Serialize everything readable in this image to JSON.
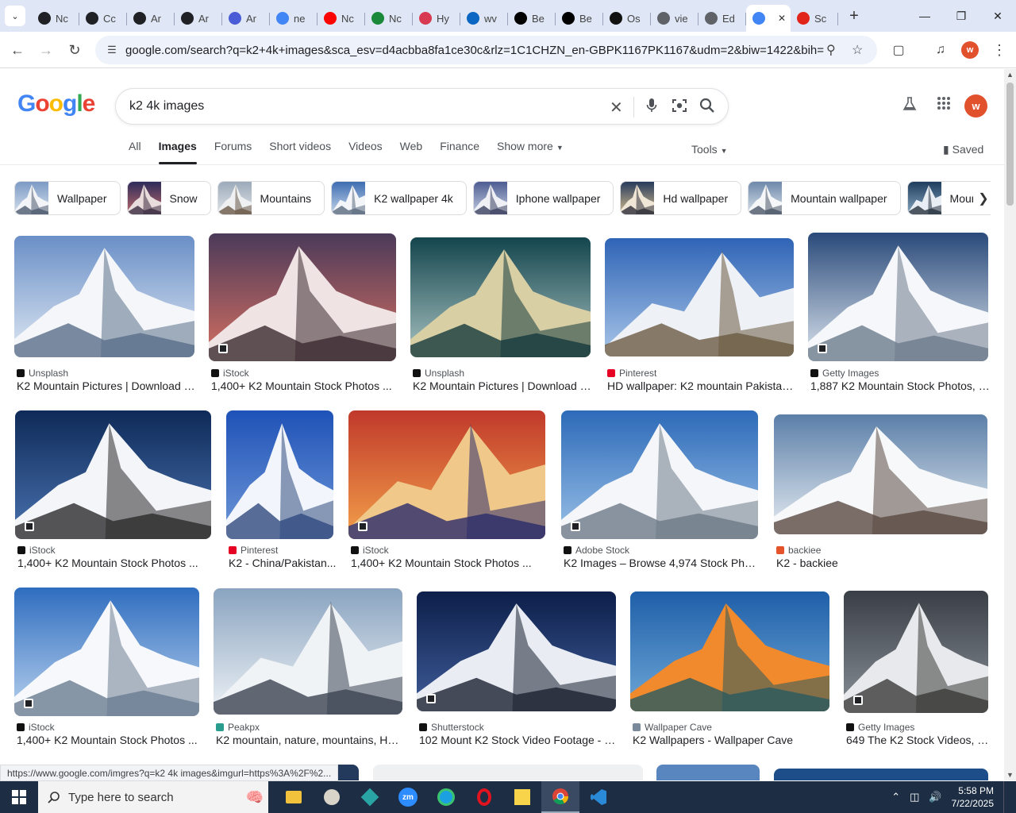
{
  "browser": {
    "tabs": [
      {
        "label": "Nc",
        "icon": "openai-icon",
        "color": "#202124"
      },
      {
        "label": "Cc",
        "icon": "openai-icon",
        "color": "#202124"
      },
      {
        "label": "Ar",
        "icon": "openai-icon",
        "color": "#202124"
      },
      {
        "label": "Ar",
        "icon": "openai-icon",
        "color": "#202124"
      },
      {
        "label": "Ar",
        "icon": "ai-icon",
        "color": "#4a5cd6"
      },
      {
        "label": "ne",
        "icon": "google-icon",
        "color": "#4285f4"
      },
      {
        "label": "Nc",
        "icon": "youtube-icon",
        "color": "#ff0000"
      },
      {
        "label": "Nc",
        "icon": "w-icon",
        "color": "#1a8a3a"
      },
      {
        "label": "Hy",
        "icon": "tag-icon",
        "color": "#d83a52"
      },
      {
        "label": "wv",
        "icon": "linkedin-icon",
        "color": "#0a66c2"
      },
      {
        "label": "Be",
        "icon": "x-icon",
        "color": "#000000"
      },
      {
        "label": "Be",
        "icon": "x-icon",
        "color": "#000000"
      },
      {
        "label": "Os",
        "icon": "asterisk-icon",
        "color": "#111111"
      },
      {
        "label": "vie",
        "icon": "globe-icon",
        "color": "#5f6368"
      },
      {
        "label": "Ed",
        "icon": "globe-icon",
        "color": "#5f6368"
      },
      {
        "label": "",
        "icon": "google-icon",
        "color": "#4285f4",
        "active": true
      },
      {
        "label": "Sc",
        "icon": "adobe-icon",
        "color": "#e1251b"
      }
    ],
    "url": "google.com/search?q=k2+4k+images&sca_esv=d4acbba8fa1ce30c&rlz=1C1CHZN_en-GBPK1167PK1167&udm=2&biw=1422&bih=996&s...",
    "profile_initial": "w"
  },
  "google": {
    "logo": "Google",
    "query": "k2 4k images",
    "profile_initial": "w",
    "tabs": [
      "All",
      "Images",
      "Forums",
      "Short videos",
      "Videos",
      "Web",
      "Finance",
      "Show more"
    ],
    "active_tab": "Images",
    "tools": "Tools",
    "saved": "Saved"
  },
  "chips": [
    "Wallpaper",
    "Snow",
    "Mountains",
    "K2 wallpaper 4k",
    "Iphone wallpaper",
    "Hd wallpaper",
    "Mountain wallpaper",
    "Mountain range"
  ],
  "results": [
    {
      "source": "Unsplash",
      "title": "K2 Mountain Pictures | Download F...",
      "sky": "#6a8fc7",
      "sky2": "#dfe8f3",
      "peak": "#f4f6f9",
      "shadow": "#5a6f8a"
    },
    {
      "source": "iStock",
      "title": "1,400+ K2 Mountain Stock Photos ...",
      "sky": "#4b3a5a",
      "sky2": "#d77061",
      "peak": "#efe3e3",
      "shadow": "#3b2a30"
    },
    {
      "source": "Unsplash",
      "title": "K2 Mountain Pictures | Download F...",
      "sky": "#14454d",
      "sky2": "#a8c3c2",
      "peak": "#d9cfa4",
      "shadow": "#143a3c"
    },
    {
      "source": "Pinterest",
      "title": "HD wallpaper: K2 mountain Pakistan ...",
      "sky": "#2f64b6",
      "sky2": "#a9c6e8",
      "peak": "#eef2f7",
      "shadow": "#6c5a42"
    },
    {
      "source": "Getty Images",
      "title": "1,887 K2 Mountain Stock Photos, H...",
      "sky": "#2a4a7a",
      "sky2": "#dde6ef",
      "peak": "#f5f7fa",
      "shadow": "#6b7a8c"
    },
    {
      "source": "iStock",
      "title": "1,400+ K2 Mountain Stock Photos ...",
      "sky": "#0e2a58",
      "sky2": "#4a73b0",
      "peak": "#f3f5f8",
      "shadow": "#2c2a2c"
    },
    {
      "source": "Pinterest",
      "title": "K2 - China/Pakistan...",
      "sky": "#1f52b7",
      "sky2": "#6f98d8",
      "peak": "#f2f5fb",
      "shadow": "#2f4b80"
    },
    {
      "source": "iStock",
      "title": "1,400+ K2 Mountain Stock Photos ...",
      "sky": "#c0392b",
      "sky2": "#f3a04a",
      "peak": "#f0c98a",
      "shadow": "#2b2a6a"
    },
    {
      "source": "Adobe Stock",
      "title": "K2 Images – Browse 4,974 Stock Photo...",
      "sky": "#2d6ab8",
      "sky2": "#9cc2e8",
      "peak": "#f4f6f9",
      "shadow": "#6d7a88"
    },
    {
      "source": "backiee",
      "title": "K2 - backiee",
      "sky": "#5b7fa8",
      "sky2": "#e6ecf2",
      "peak": "#f7f8fa",
      "shadow": "#5a4a42"
    },
    {
      "source": "iStock",
      "title": "1,400+ K2 Mountain Stock Photos ...",
      "sky": "#2f6dbf",
      "sky2": "#b9d2ee",
      "peak": "#f6f8fb",
      "shadow": "#6c7d92"
    },
    {
      "source": "Peakpx",
      "title": "K2 mountain, nature, mountains, HD ...",
      "sky": "#8aa4c0",
      "sky2": "#eef2f6",
      "peak": "#f0f3f6",
      "shadow": "#3c4452"
    },
    {
      "source": "Shutterstock",
      "title": "102 Mount K2 Stock Video Footage - 4...",
      "sky": "#0d1f4a",
      "sky2": "#3f5d9a",
      "peak": "#e9edf3",
      "shadow": "#1a2030"
    },
    {
      "source": "Wallpaper Cave",
      "title": "K2 Wallpapers - Wallpaper Cave",
      "sky": "#1f5fa8",
      "sky2": "#6fa8d8",
      "peak": "#f08a2c",
      "shadow": "#2a5a60"
    },
    {
      "source": "Getty Images",
      "title": "649 The K2 Stock Videos, F...",
      "sky": "#3a3f46",
      "sky2": "#8a9098",
      "peak": "#e7e9ec",
      "shadow": "#3a3a38"
    }
  ],
  "status_url": "https://www.google.com/imgres?q=k2 4k images&imgurl=https%3A%2F%2...",
  "taskbar": {
    "search_placeholder": "Type here to search",
    "time": "5:58 PM",
    "date": "7/22/2025"
  }
}
